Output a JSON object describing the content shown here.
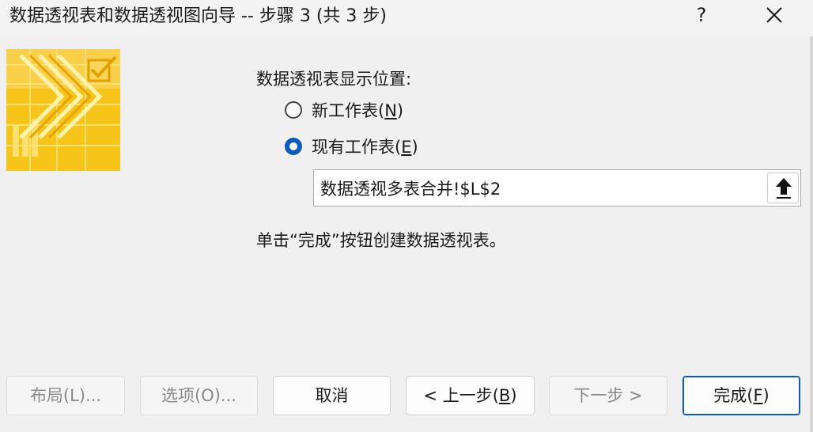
{
  "window": {
    "title": "数据透视表和数据透视图向导 -- 步骤 3 (共 3 步)",
    "help_label": "?",
    "close_icon": "close-icon"
  },
  "colors": {
    "accent": "#0a5cbe",
    "banner_yellow": "#f7c51a",
    "banner_light": "#fde580",
    "banner_dark": "#e0a800"
  },
  "placement": {
    "label": "数据透视表显示位置:",
    "options": [
      {
        "text": "新工作表(",
        "key": "N",
        "suffix": ")",
        "checked": false
      },
      {
        "text": "现有工作表(",
        "key": "E",
        "suffix": ")",
        "checked": true
      }
    ],
    "location_value": "数据透视多表合并!$L$2",
    "collapse_icon": "arrow-up-icon"
  },
  "hint": "单击“完成”按钮创建数据透视表。",
  "buttons": {
    "layout": "布局(L)...",
    "options": "选项(O)...",
    "cancel": "取消",
    "back_prefix": "< 上一步(",
    "back_key": "B",
    "back_suffix": ")",
    "next": "下一步 >",
    "finish_prefix": "完成(",
    "finish_key": "F",
    "finish_suffix": ")"
  }
}
